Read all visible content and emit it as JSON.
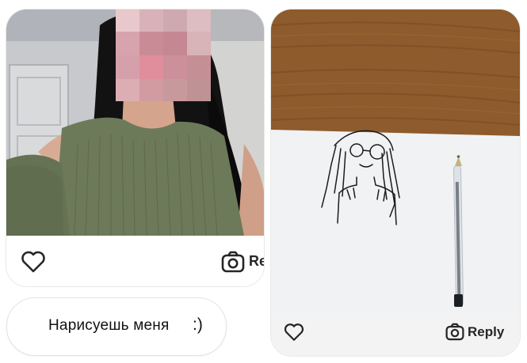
{
  "left_post": {
    "reply_label": "Re",
    "message_text": "Нарисуешь меня",
    "message_emoticon": ":)"
  },
  "right_post": {
    "reply_label": "Reply"
  },
  "icons": {
    "left_like": "heart-icon",
    "left_reply": "camera-icon",
    "right_like": "heart-icon",
    "right_reply": "camera-icon"
  },
  "colors": {
    "icon": "#262626",
    "sweater": "#6d7a5a",
    "table_wood": "#8b5a2b",
    "paper": "#f1f2f4"
  }
}
